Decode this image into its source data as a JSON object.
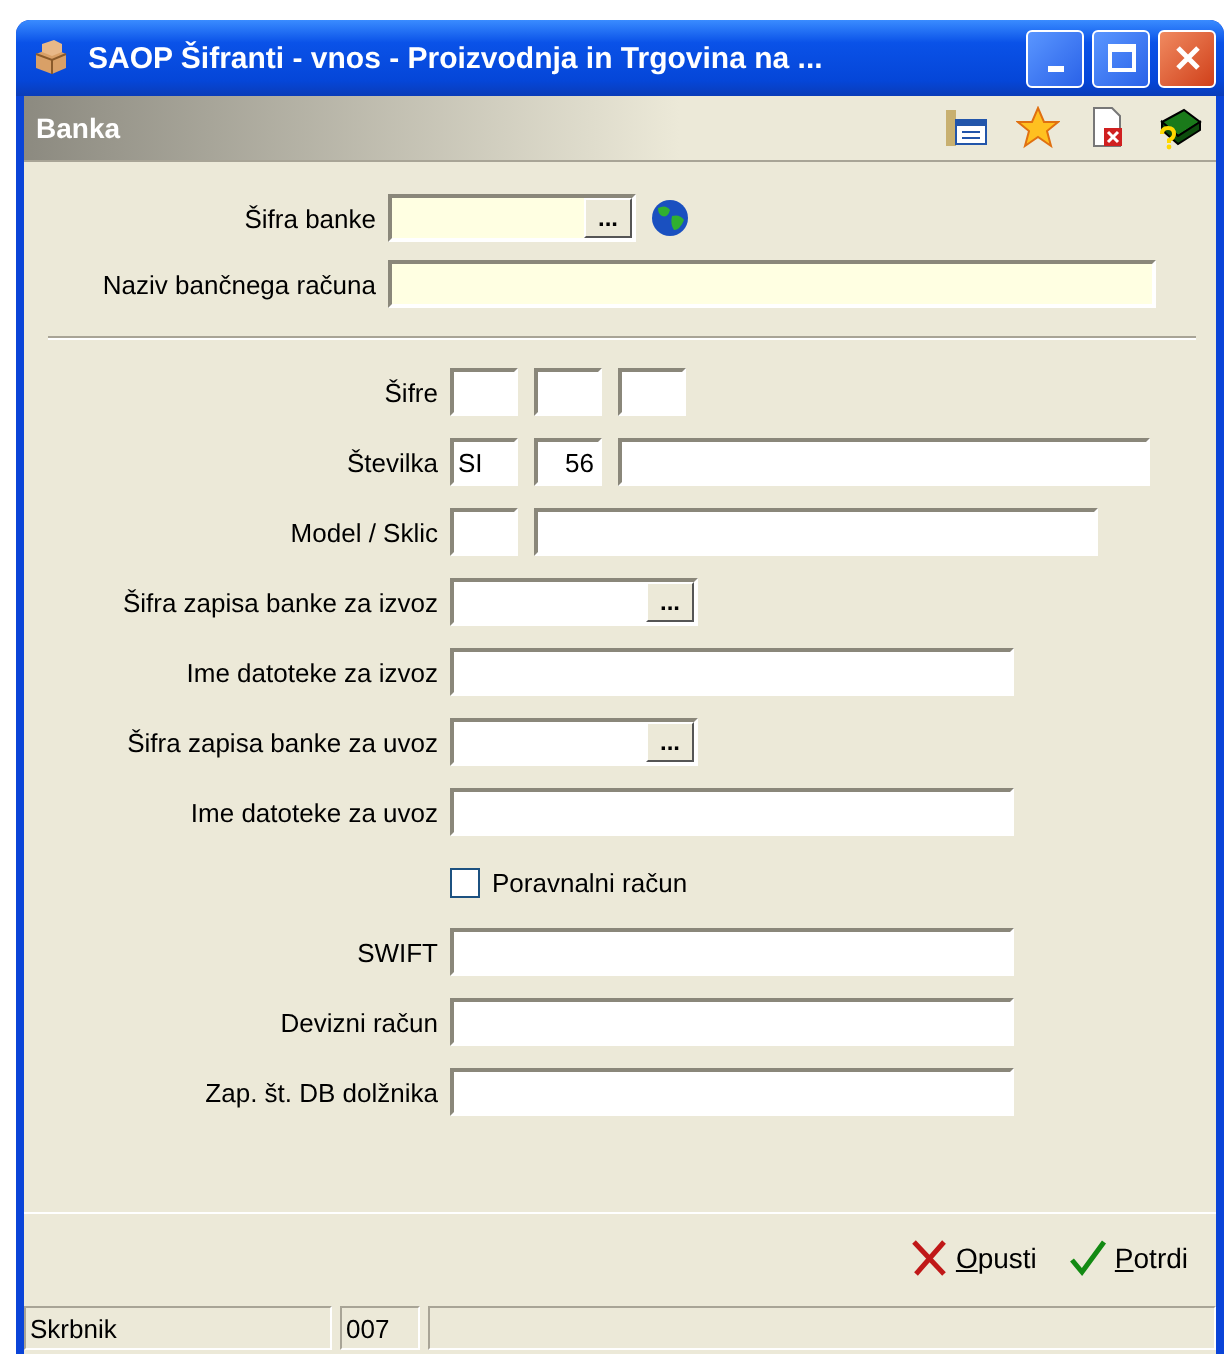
{
  "window": {
    "title": "SAOP  Šifranti - vnos - Proizvodnja in Trgovina na ..."
  },
  "header": {
    "title": "Banka"
  },
  "sections": [
    {
      "rows": [
        {
          "kind": "field",
          "label": "Šifra banke",
          "fields": [
            {
              "kind": "lookup",
              "button": "...",
              "required": true
            },
            {
              "kind": "globe"
            }
          ]
        },
        {
          "kind": "field",
          "label": "Naziv bančnega računa",
          "fields": [
            {
              "kind": "text",
              "required": true
            }
          ]
        }
      ]
    },
    {
      "rows": [
        {
          "kind": "field",
          "label": "Šifre",
          "fields": [
            {
              "kind": "code"
            },
            {
              "kind": "code"
            },
            {
              "kind": "code"
            }
          ]
        },
        {
          "kind": "field",
          "label": "Številka",
          "fields": [
            {
              "kind": "code",
              "value": "SI",
              "right_aligned": false
            },
            {
              "kind": "code",
              "value": "56",
              "right_aligned": true
            },
            {
              "kind": "text",
              "required": false
            }
          ]
        },
        {
          "kind": "field",
          "label": "Model / Sklic",
          "fields": [
            {
              "kind": "code"
            },
            {
              "kind": "text",
              "required": false
            }
          ]
        },
        {
          "kind": "field",
          "label": "Šifra zapisa banke za izvoz",
          "fields": [
            {
              "kind": "lookup",
              "button": "...",
              "required": false
            }
          ]
        },
        {
          "kind": "field",
          "label": "Ime datoteke za izvoz",
          "fields": [
            {
              "kind": "text",
              "required": false
            }
          ]
        },
        {
          "kind": "field",
          "label": "Šifra zapisa banke za uvoz",
          "fields": [
            {
              "kind": "lookup",
              "button": "...",
              "required": false
            }
          ]
        },
        {
          "kind": "field",
          "label": "Ime datoteke za uvoz",
          "fields": [
            {
              "kind": "text",
              "required": false
            }
          ]
        },
        {
          "kind": "checkbox",
          "label": "Poravnalni račun",
          "checked": false
        },
        {
          "kind": "field",
          "label": "SWIFT",
          "fields": [
            {
              "kind": "text",
              "required": false
            }
          ]
        },
        {
          "kind": "field",
          "label": "Devizni račun",
          "fields": [
            {
              "kind": "text",
              "required": false
            }
          ]
        },
        {
          "kind": "field",
          "label": "Zap. št. DB dolžnika",
          "fields": [
            {
              "kind": "text",
              "required": false
            }
          ]
        }
      ]
    }
  ],
  "buttons": [
    {
      "kind": "cancel",
      "label": "Opusti"
    },
    {
      "kind": "ok",
      "label": "Potrdi"
    }
  ],
  "status_bar": [
    "Skrbnik",
    "007"
  ]
}
